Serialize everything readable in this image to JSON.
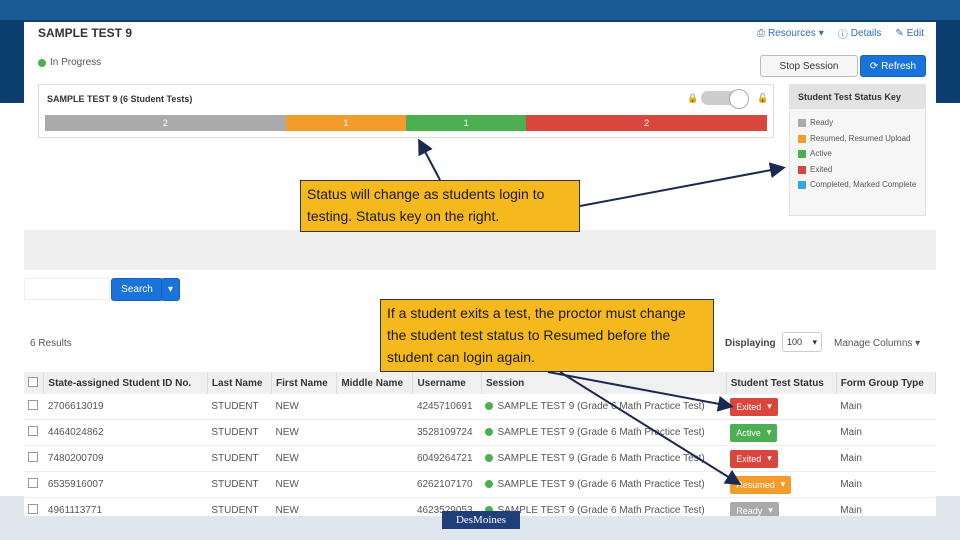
{
  "app": {
    "title": "SAMPLE TEST 9",
    "links": {
      "resources": "Resources",
      "details": "Details",
      "edit": "Edit"
    },
    "session_status": "In Progress",
    "buttons": {
      "stop_session": "Stop Session",
      "refresh": "Refresh"
    }
  },
  "session_box": {
    "title": "SAMPLE TEST 9 (6 Student Tests)",
    "progress": [
      {
        "label": "2",
        "color": "#aaaaaa",
        "count": 2
      },
      {
        "label": "1",
        "color": "#f39c2b",
        "count": 1
      },
      {
        "label": "1",
        "color": "#4caf50",
        "count": 1
      },
      {
        "label": "2",
        "color": "#d9463e",
        "count": 2
      }
    ]
  },
  "status_key": {
    "title": "Student Test Status Key",
    "items": [
      {
        "label": "Ready",
        "color": "#aaaaaa"
      },
      {
        "label": "Resumed, Resumed Upload",
        "color": "#f39c2b"
      },
      {
        "label": "Active",
        "color": "#4caf50"
      },
      {
        "label": "Exited",
        "color": "#d9463e"
      },
      {
        "label": "Completed, Marked Complete",
        "color": "#31a8d9"
      }
    ]
  },
  "search": {
    "button": "Search",
    "caret": "▾"
  },
  "results_bar": {
    "results": "6 Results",
    "displaying": "Displaying",
    "page_size": "100",
    "manage_columns": "Manage Columns"
  },
  "table": {
    "headers": [
      "State-assigned Student ID No.",
      "Last Name",
      "First Name",
      "Middle Name",
      "Username",
      "Session",
      "Student Test Status",
      "Form Group Type"
    ],
    "rows": [
      {
        "id": "2706613019",
        "last": "STUDENT",
        "first": "NEW",
        "middle": "",
        "username": "4245710691",
        "session": "SAMPLE TEST 9 (Grade 6 Math Practice Test)",
        "status": "Exited",
        "status_color": "#d9463e",
        "form": "Main"
      },
      {
        "id": "4464024862",
        "last": "STUDENT",
        "first": "NEW",
        "middle": "",
        "username": "3528109724",
        "session": "SAMPLE TEST 9 (Grade 6 Math Practice Test)",
        "status": "Active",
        "status_color": "#4caf50",
        "form": "Main"
      },
      {
        "id": "7480200709",
        "last": "STUDENT",
        "first": "NEW",
        "middle": "",
        "username": "6049264721",
        "session": "SAMPLE TEST 9 (Grade 6 Math Practice Test)",
        "status": "Exited",
        "status_color": "#d9463e",
        "form": "Main"
      },
      {
        "id": "6535916007",
        "last": "STUDENT",
        "first": "NEW",
        "middle": "",
        "username": "6262107170",
        "session": "SAMPLE TEST 9 (Grade 6 Math Practice Test)",
        "status": "Resumed",
        "status_color": "#f39c2b",
        "form": "Main"
      },
      {
        "id": "4961113771",
        "last": "STUDENT",
        "first": "NEW",
        "middle": "",
        "username": "4623529053",
        "session": "SAMPLE TEST 9 (Grade 6 Math Practice Test)",
        "status": "Ready",
        "status_color": "#aaaaaa",
        "form": "Main"
      }
    ]
  },
  "callouts": {
    "one": "Status will change as students login to testing. Status key on the right.",
    "two": "If a student exits a test, the proctor must change the student test status to Resumed before the student can login again."
  },
  "logo": "DesMoines"
}
